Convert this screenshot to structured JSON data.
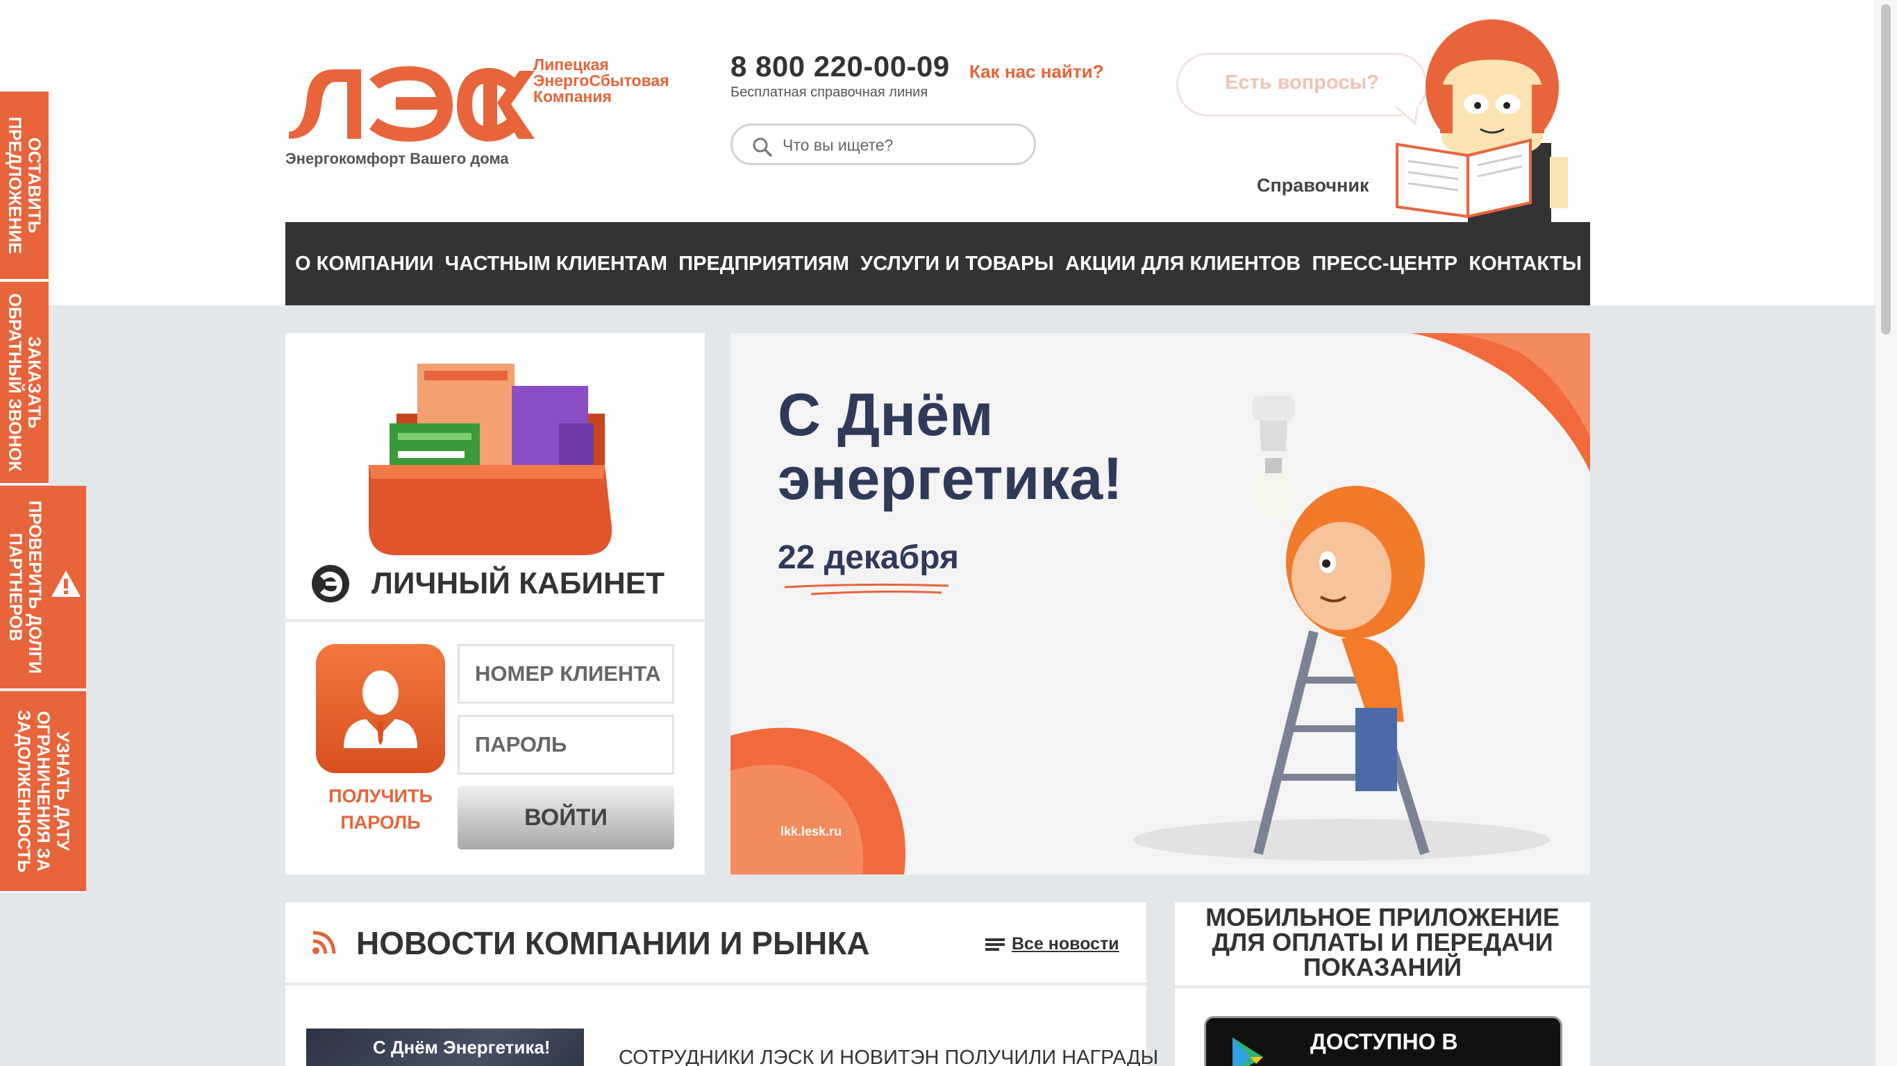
{
  "brand": {
    "logo_text": "ЛЭСК",
    "company_name_lines": [
      "Липецкая",
      "ЭнергоСбытовая",
      "Компания"
    ],
    "tagline": "Энергокомфорт Вашего дома",
    "accent_color": "#e8643a",
    "nav_color": "#333333"
  },
  "contact": {
    "phone": "8 800 220-00-09",
    "phone_note": "Бесплатная справочная линия",
    "find_us": "Как нас найти?"
  },
  "search": {
    "placeholder": "Что вы ищете?"
  },
  "helper": {
    "bubble_text": "Есть вопросы?",
    "handbook_label": "Справочник"
  },
  "nav": {
    "items": [
      "О КОМПАНИИ",
      "ЧАСТНЫМ КЛИЕНТАМ",
      "ПРЕДПРИЯТИЯМ",
      "УСЛУГИ И ТОВАРЫ",
      "АКЦИИ ДЛЯ КЛИЕНТОВ",
      "ПРЕСС-ЦЕНТР",
      "КОНТАКТЫ"
    ]
  },
  "cabinet": {
    "title": "ЛИЧНЫЙ КАБИНЕТ",
    "client_number_placeholder": "НОМЕР КЛИЕНТА",
    "password_placeholder": "ПАРОЛЬ",
    "login_button": "ВОЙТИ",
    "get_password_lines": [
      "ПОЛУЧИТЬ",
      "ПАРОЛЬ"
    ]
  },
  "banner": {
    "title_lines": [
      "С Днём",
      "энергетика!"
    ],
    "date": "22 декабря",
    "url": "lkk.lesk.ru"
  },
  "news": {
    "title": "НОВОСТИ КОМПАНИИ И РЫНКА",
    "all_news": "Все новости",
    "items": [
      {
        "thumb_text": "С Днём Энергетика!",
        "title": "СОТРУДНИКИ ЛЭСК И НОВИТЭН ПОЛУЧИЛИ НАГРАДЫ"
      }
    ]
  },
  "app": {
    "title_lines": [
      "МОБИЛЬНОЕ ПРИЛОЖЕНИЕ",
      "ДЛЯ ОПЛАТЫ И ПЕРЕДАЧИ",
      "ПОКАЗАНИЙ"
    ],
    "store_text": "ДОСТУПНО В"
  },
  "side_tabs": [
    {
      "label": "ОСТАВИТЬ ПРЕДЛОЖЕНИЕ"
    },
    {
      "label": "ЗАКАЗАТЬ ОБРАТНЫЙ ЗВОНОК"
    },
    {
      "label": "ПРОВЕРИТЬ ДОЛГИ ПАРТНЕРОВ"
    },
    {
      "label": "УЗНАТЬ ДАТУ ОГРАНИЧЕНИЯ ЗА ЗАДОЛЖЕННОСТЬ"
    }
  ]
}
